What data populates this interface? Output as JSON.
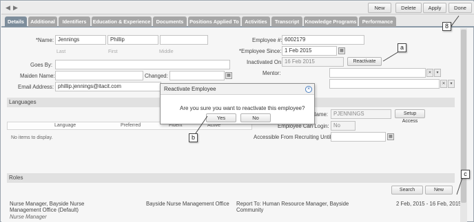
{
  "toolbar": {
    "back_icon": "◀",
    "forward_icon": "▶",
    "buttons": [
      "New",
      "Delete",
      "Apply",
      "Done"
    ]
  },
  "tabs": [
    "Details",
    "Additional",
    "Identifiers",
    "Education & Experience",
    "Documents",
    "Positions Applied To",
    "Activities",
    "Transcript",
    "Knowledge Programs",
    "Performance"
  ],
  "active_tab": "Details",
  "form": {
    "name_label": "*Name:",
    "last_name": "Jennings",
    "first_name": "Phillip",
    "middle_name": "",
    "last_caption": "Last",
    "first_caption": "First",
    "middle_caption": "Middle",
    "goes_by_label": "Goes By:",
    "goes_by": "",
    "maiden_label": "Maiden Name:",
    "maiden": "",
    "changed_label": "Changed:",
    "email_label": "Email Address:",
    "email": "phillip.jennings@itacit.com",
    "employee_num_label": "Employee #:",
    "employee_num": "6002179",
    "employee_since_label": "*Employee Since:",
    "employee_since": "1 Feb 2015",
    "inactivated_label": "Inactivated On:",
    "inactivated": "16 Feb 2015",
    "reactivate_button": "Reactivate",
    "mentor_label": "Mentor:",
    "name2_label": "Name:",
    "username": "PJENNINGS",
    "setup_access_button": "Setup Access",
    "can_login_label": "Employee Can Login:",
    "can_login": "No",
    "recruiting_label": "Accessible From Recruiting Until:",
    "recruiting": ""
  },
  "languages": {
    "title": "Languages",
    "columns": [
      "Language",
      "Preferred",
      "Fluent",
      "Active"
    ],
    "empty_text": "No items to display."
  },
  "roles": {
    "title": "Roles",
    "search_button": "Search",
    "new_button": "New",
    "row": {
      "role": "Nurse Manager, Bayside Nurse Management Office (Default)",
      "role_sub": "Nurse Manager",
      "office": "Bayside Nurse Management Office",
      "report_to": "Report To: Human Resource Manager, Bayside Community",
      "dates": "2 Feb, 2015 - 16 Feb, 2015"
    }
  },
  "dialog": {
    "title": "Reactivate Employee",
    "message": "Are you sure you want to reactivate this employee?",
    "yes": "Yes",
    "no": "No",
    "close_icon": "×"
  },
  "callouts": [
    "a",
    "b",
    "c",
    "8"
  ],
  "icons": {
    "calendar": "▦",
    "clear": "✕",
    "dropdown": "▾"
  }
}
